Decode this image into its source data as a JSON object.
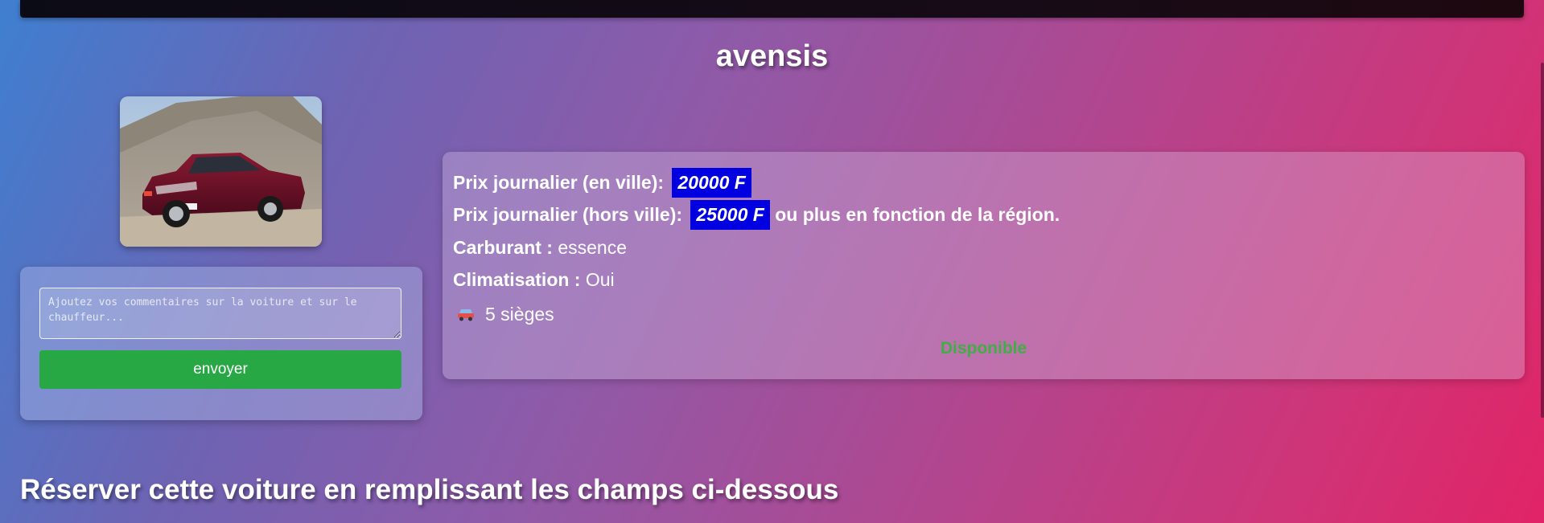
{
  "car": {
    "name": "avensis",
    "photo_alt": "avensis",
    "price_city_label": "Prix journalier (en ville):",
    "price_city_value": "20000 F",
    "price_outside_label": "Prix journalier (hors ville):",
    "price_outside_value": "25000 F",
    "price_outside_suffix": "ou plus en fonction de la région.",
    "fuel_label": "Carburant :",
    "fuel_value": "essence",
    "ac_label": "Climatisation :",
    "ac_value": "Oui",
    "seats_icon": "car-icon",
    "seats": "5 sièges",
    "status": "Disponible"
  },
  "comment": {
    "placeholder": "Ajoutez vos commentaires sur la voiture et sur le chauffeur...",
    "value": "",
    "submit_label": "envoyer"
  },
  "reservation": {
    "heading": "Réserver cette voiture en remplissant les champs ci-dessous"
  },
  "colors": {
    "price_highlight": "#0000e0",
    "button_green": "#28a745",
    "status_green": "#3fae45"
  }
}
